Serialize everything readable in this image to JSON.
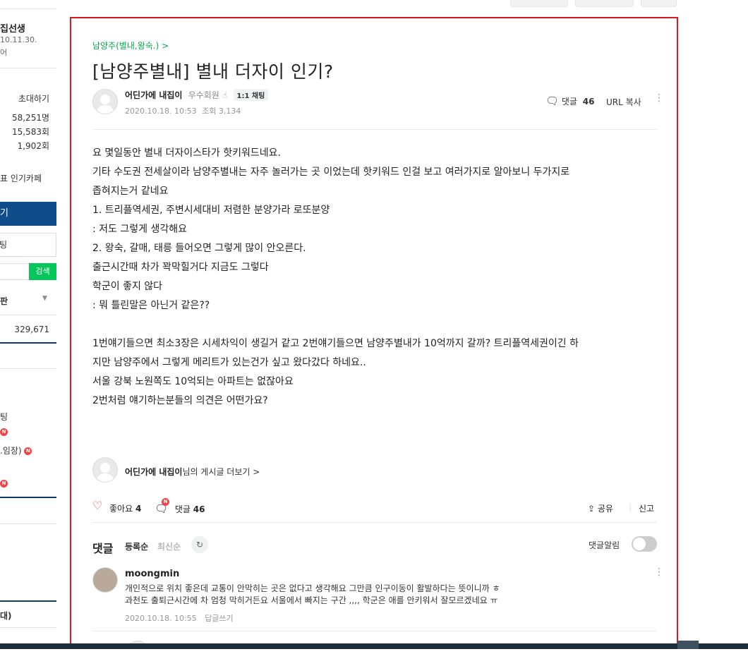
{
  "sidebar": {
    "cafe_name_partial": "집선생",
    "date_partial": "10.11.30.",
    "line3": "어",
    "invite": "초대하기",
    "members": "58,251명",
    "visits": "15,583회",
    "posts": "1,902회",
    "popular": "표 인기카페",
    "blue_btn": "기",
    "input_text": "팅",
    "search_btn": "검색",
    "select_text": "판",
    "count": "329,671",
    "item_a": "팅",
    "item_b": ".임장)",
    "item_c": "대)"
  },
  "article": {
    "cafe_menu": "남양주(별내,왕숙.) >",
    "title": "[남양주별내] 별내 더자이 인기?",
    "author": "어딘가에 내집이",
    "grade": "우수회원",
    "chat_label": "1:1 채팅",
    "date": "2020.10.18. 10:53",
    "views_label": "조회 3,134",
    "comment_label": "댓글",
    "comment_count": "46",
    "url_copy": "URL 복사",
    "body": "요 몇일동안 별내 더자이스타가 핫키워드네요.\n기타 수도권 전세살이라 남양주별내는 자주 놀러가는 곳 이었는데 핫키워드 인걸 보고 여러가지로 알아보니 두가지로\n좁혀지는거 같네요\n1. 트리플역세권, 주변시세대비 저렴한 분양가라 로또분양\n: 저도 그렇게 생각해요\n2. 왕숙, 갈매, 태릉 들어오면 그렇게 많이 안오른다.\n출근시간때 차가 꽉막힐거다 지금도 그렇다\n학군이 좋지 않다\n: 뭐 틀린말은 아닌거 같은??\n\n1번얘기들으면 최소3장은 시세차익이 생길거 같고 2번얘기들으면 남양주별내가 10억까지 갈까? 트리플역세권이긴 하\n지만 남양주에서 그렇게 메리트가 있는건가 싶고 왔다갔다 하네요..\n서울 강북 노원쪽도 10억되는 아파트는 없잖아요\n2번처럼 얘기하는분들의 의견은 어떤가요?",
    "more_author": "어딘가에 내집이",
    "more_suffix": "님의 게시글 더보기 >",
    "like_label": "좋아요",
    "like_count": "4",
    "comment2_label": "댓글",
    "comment2_count": "46",
    "new_badge": "N",
    "share_label": "공유",
    "report_label": "신고"
  },
  "comments": {
    "title": "댓글",
    "sort_reg": "등록순",
    "sort_new": "최신순",
    "alarm_label": "댓글알림",
    "items": [
      {
        "user": "moongmin",
        "text1": "개인적으로 위치 좋은데 교통이 안막히는 곳은 없다고 생각해요 그만큼 인구이동이 활발하다는 뜻이니까 ㅎ",
        "text2": "과천도 출퇴근시간에 차 엄청 막히거든요 서울에서 빠지는 구간 ,,,, 학군은 애를 안키워서 잘모르겠네요 ㅠ",
        "date": "2020.10.18. 10:55",
        "reply": "답글쓰기"
      }
    ]
  },
  "colors": {
    "accent_green": "#03c75a",
    "border_red": "#e0161d",
    "heart_red": "#f04343",
    "navy": "#0f4c8a"
  }
}
